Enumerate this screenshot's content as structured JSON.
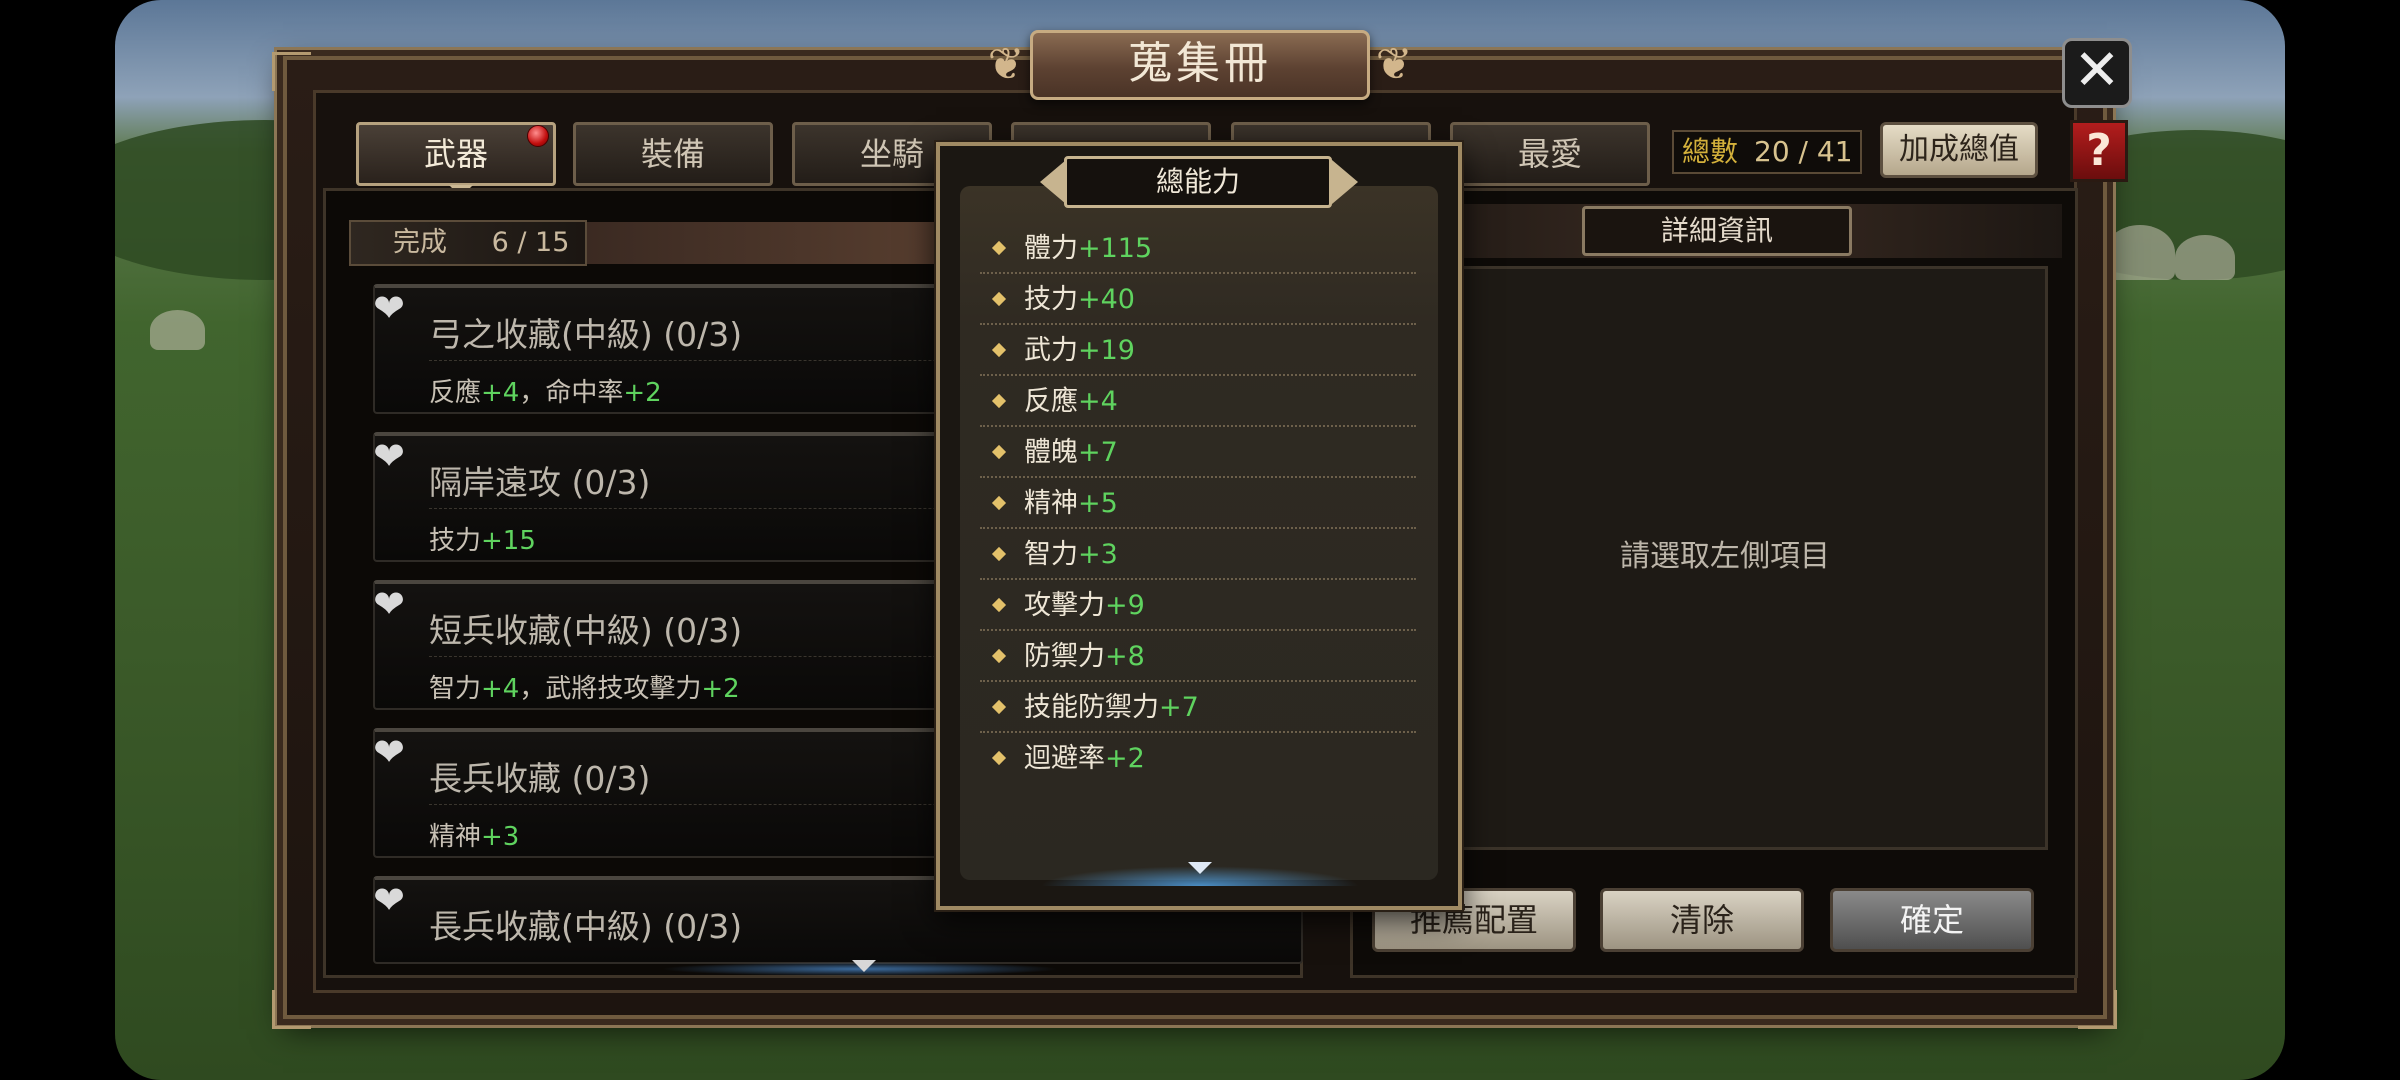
{
  "title": "蒐集冊",
  "tabs": [
    {
      "label": "武器",
      "active": true,
      "notify": true
    },
    {
      "label": "裝備",
      "active": false
    },
    {
      "label": "坐騎",
      "active": false
    },
    {
      "label": "",
      "active": false
    },
    {
      "label": "",
      "active": false
    },
    {
      "label": "最愛",
      "active": false
    }
  ],
  "count": {
    "label": "總數",
    "value": "20 / 41"
  },
  "bonus_button": "加成總值",
  "help_button": "?",
  "close_button": "✕",
  "completion": {
    "label": "完成",
    "value": "6 / 15"
  },
  "collections": [
    {
      "title": "弓之收藏(中級) (0/3)",
      "effects": [
        {
          "name": "反應",
          "bonus": "+4"
        },
        {
          "name": "命中率",
          "bonus": "+2"
        }
      ]
    },
    {
      "title": "隔岸遠攻 (0/3)",
      "effects": [
        {
          "name": "技力",
          "bonus": "+15"
        }
      ]
    },
    {
      "title": "短兵收藏(中級) (0/3)",
      "effects": [
        {
          "name": "智力",
          "bonus": "+4"
        },
        {
          "name": "武將技攻擊力",
          "bonus": "+2"
        }
      ]
    },
    {
      "title": "長兵收藏 (0/3)",
      "effects": [
        {
          "name": "精神",
          "bonus": "+3"
        }
      ]
    },
    {
      "title": "長兵收藏(中級) (0/3)",
      "effects": []
    }
  ],
  "detail": {
    "header": "詳細資訊",
    "placeholder": "請選取左側項目"
  },
  "actions": {
    "recommend": "推薦配置",
    "clear": "清除",
    "confirm": "確定"
  },
  "popup": {
    "title": "總能力",
    "stats": [
      {
        "name": "體力",
        "bonus": "+115"
      },
      {
        "name": "技力",
        "bonus": "+40"
      },
      {
        "name": "武力",
        "bonus": "+19"
      },
      {
        "name": "反應",
        "bonus": "+4"
      },
      {
        "name": "體魄",
        "bonus": "+7"
      },
      {
        "name": "精神",
        "bonus": "+5"
      },
      {
        "name": "智力",
        "bonus": "+3"
      },
      {
        "name": "攻擊力",
        "bonus": "+9"
      },
      {
        "name": "防禦力",
        "bonus": "+8"
      },
      {
        "name": "技能防禦力",
        "bonus": "+7"
      },
      {
        "name": "迴避率",
        "bonus": "+2"
      }
    ]
  },
  "colors": {
    "bonus_green": "#5fd35f",
    "count_gold": "#d4b13b",
    "frame_gold": "#c7ab82"
  },
  "icons": {
    "close": "close-icon",
    "help": "question-mark-icon",
    "heart": "heart-icon",
    "diamond": "diamond-bullet-icon",
    "scroll": "chevron-down-icon"
  }
}
